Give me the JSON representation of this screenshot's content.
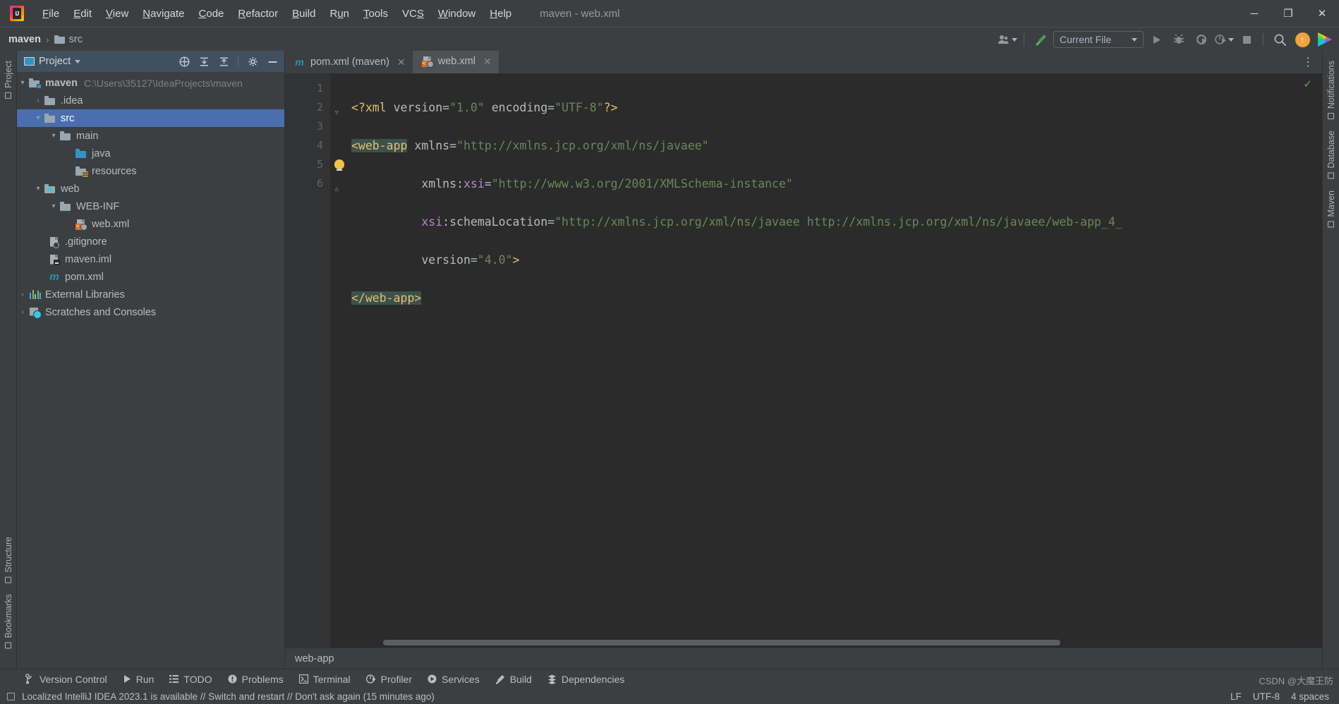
{
  "window": {
    "title": "maven - web.xml",
    "logo_text": "IJ",
    "controls": {
      "minimize": "─",
      "maximize": "❐",
      "close": "✕"
    }
  },
  "menubar": {
    "items": [
      {
        "label": "File",
        "mnemonic": "F"
      },
      {
        "label": "Edit",
        "mnemonic": "E"
      },
      {
        "label": "View",
        "mnemonic": "V"
      },
      {
        "label": "Navigate",
        "mnemonic": "N"
      },
      {
        "label": "Code",
        "mnemonic": "C"
      },
      {
        "label": "Refactor",
        "mnemonic": "R"
      },
      {
        "label": "Build",
        "mnemonic": "B"
      },
      {
        "label": "Run",
        "mnemonic": "u"
      },
      {
        "label": "Tools",
        "mnemonic": "T"
      },
      {
        "label": "VCS",
        "mnemonic": "S"
      },
      {
        "label": "Window",
        "mnemonic": "W"
      },
      {
        "label": "Help",
        "mnemonic": "H"
      }
    ]
  },
  "navbar": {
    "breadcrumbs": [
      "maven",
      "src"
    ],
    "separator": "›",
    "run_config": "Current File",
    "icons": {
      "account": "account-icon",
      "build_hammer": "hammer-icon",
      "run": "▶",
      "debug": "debug-icon",
      "coverage": "coverage-icon",
      "profiler": "profiler-icon",
      "stop": "■",
      "search": "⌕",
      "update": "↑"
    }
  },
  "project_panel": {
    "title": "Project",
    "toolbar_icons": [
      "select-opened-file-icon",
      "expand-all-icon",
      "collapse-all-icon",
      "settings-gear-icon",
      "hide-icon"
    ],
    "tree": [
      {
        "label": "maven",
        "path": "C:\\Users\\35127\\IdeaProjects\\maven",
        "indent": 0,
        "arrow": "⌄",
        "icon": "project-folder",
        "bold": true,
        "selected": false
      },
      {
        "label": ".idea",
        "path": "",
        "indent": 1,
        "arrow": "›",
        "icon": "folder-grey",
        "bold": false,
        "selected": false
      },
      {
        "label": "src",
        "path": "",
        "indent": 1,
        "arrow": "⌄",
        "icon": "folder-grey",
        "bold": false,
        "selected": true
      },
      {
        "label": "main",
        "path": "",
        "indent": 2,
        "arrow": "⌄",
        "icon": "folder-grey",
        "bold": false,
        "selected": false
      },
      {
        "label": "java",
        "path": "",
        "indent": 3,
        "arrow": "",
        "icon": "folder-sources",
        "bold": false,
        "selected": false
      },
      {
        "label": "resources",
        "path": "",
        "indent": 3,
        "arrow": "",
        "icon": "folder-resources",
        "bold": false,
        "selected": false
      },
      {
        "label": "web",
        "path": "",
        "indent": 1,
        "arrow": "⌄",
        "icon": "folder-web",
        "bold": false,
        "selected": false
      },
      {
        "label": "WEB-INF",
        "path": "",
        "indent": 2,
        "arrow": "⌄",
        "icon": "folder-grey",
        "bold": false,
        "selected": false
      },
      {
        "label": "web.xml",
        "path": "",
        "indent": 3,
        "arrow": "",
        "icon": "file-xml-web",
        "bold": false,
        "selected": false
      },
      {
        "label": ".gitignore",
        "path": "",
        "indent": 2,
        "arrow": "",
        "icon": "file-gitignore",
        "bold": false,
        "selected": false
      },
      {
        "label": "maven.iml",
        "path": "",
        "indent": 2,
        "arrow": "",
        "icon": "file-iml",
        "bold": false,
        "selected": false
      },
      {
        "label": "pom.xml",
        "path": "",
        "indent": 2,
        "arrow": "",
        "icon": "file-maven",
        "bold": false,
        "selected": false
      },
      {
        "label": "External Libraries",
        "path": "",
        "indent": 0,
        "arrow": "›",
        "icon": "libraries",
        "bold": false,
        "selected": false
      },
      {
        "label": "Scratches and Consoles",
        "path": "",
        "indent": 0,
        "arrow": "›",
        "icon": "scratches",
        "bold": false,
        "selected": false
      }
    ]
  },
  "editor": {
    "tabs": [
      {
        "label": "pom.xml (maven)",
        "icon": "maven-m-icon",
        "active": false,
        "close": "✕"
      },
      {
        "label": "web.xml",
        "icon": "xml-web-icon",
        "active": true,
        "close": "✕"
      }
    ],
    "more_icon": "⋮",
    "inspection_ok": "✓",
    "lines": [
      {
        "n": "1",
        "fold": "",
        "bulb": false
      },
      {
        "n": "2",
        "fold": "−",
        "bulb": false
      },
      {
        "n": "3",
        "fold": "",
        "bulb": false
      },
      {
        "n": "4",
        "fold": "",
        "bulb": false
      },
      {
        "n": "5",
        "fold": "",
        "bulb": true
      },
      {
        "n": "6",
        "fold": "⌃",
        "bulb": false
      }
    ],
    "code": {
      "l1_pi_open": "<?xml",
      "l1_attr1": " version",
      "l1_eq": "=",
      "l1_val1": "\"1.0\"",
      "l1_attr2": " encoding",
      "l1_val2": "\"UTF-8\"",
      "l1_pi_close": "?>",
      "l2_tag": "<web-app",
      "l2_attr": " xmlns",
      "l2_val": "\"http://xmlns.jcp.org/xml/ns/javaee\"",
      "l3_ns_prefix": "xmlns:",
      "l3_ns_name": "xsi",
      "l3_val": "\"http://www.w3.org/2001/XMLSchema-instance\"",
      "l4_ns_prefix": "xsi",
      "l4_ns_name": ":schemaLocation",
      "l4_val": "\"http://xmlns.jcp.org/xml/ns/javaee http://xmlns.jcp.org/xml/ns/javaee/web-app_4_",
      "l5_attr": "version",
      "l5_val": "\"4.0\"",
      "l5_close": ">",
      "l6_tag": "</web-app>"
    },
    "status_strip": "web-app"
  },
  "tool_strips": {
    "left": [
      "Project",
      "Structure",
      "Bookmarks"
    ],
    "right": [
      "Notifications",
      "Database",
      "Maven"
    ]
  },
  "bottom_bar": {
    "items": [
      {
        "label": "Version Control",
        "icon": "branch-icon"
      },
      {
        "label": "Run",
        "icon": "▶"
      },
      {
        "label": "TODO",
        "icon": "list-icon"
      },
      {
        "label": "Problems",
        "icon": "warning-icon"
      },
      {
        "label": "Terminal",
        "icon": "terminal-icon"
      },
      {
        "label": "Profiler",
        "icon": "profiler-icon"
      },
      {
        "label": "Services",
        "icon": "services-icon"
      },
      {
        "label": "Build",
        "icon": "hammer-icon"
      },
      {
        "label": "Dependencies",
        "icon": "dependencies-icon"
      }
    ]
  },
  "status_bar": {
    "message": "Localized IntelliJ IDEA 2023.1 is available // Switch and restart // Don't ask again (15 minutes ago)",
    "line_sep": "LF",
    "encoding": "UTF-8",
    "indent": "4 spaces"
  },
  "watermark": "CSDN @大魔王防"
}
